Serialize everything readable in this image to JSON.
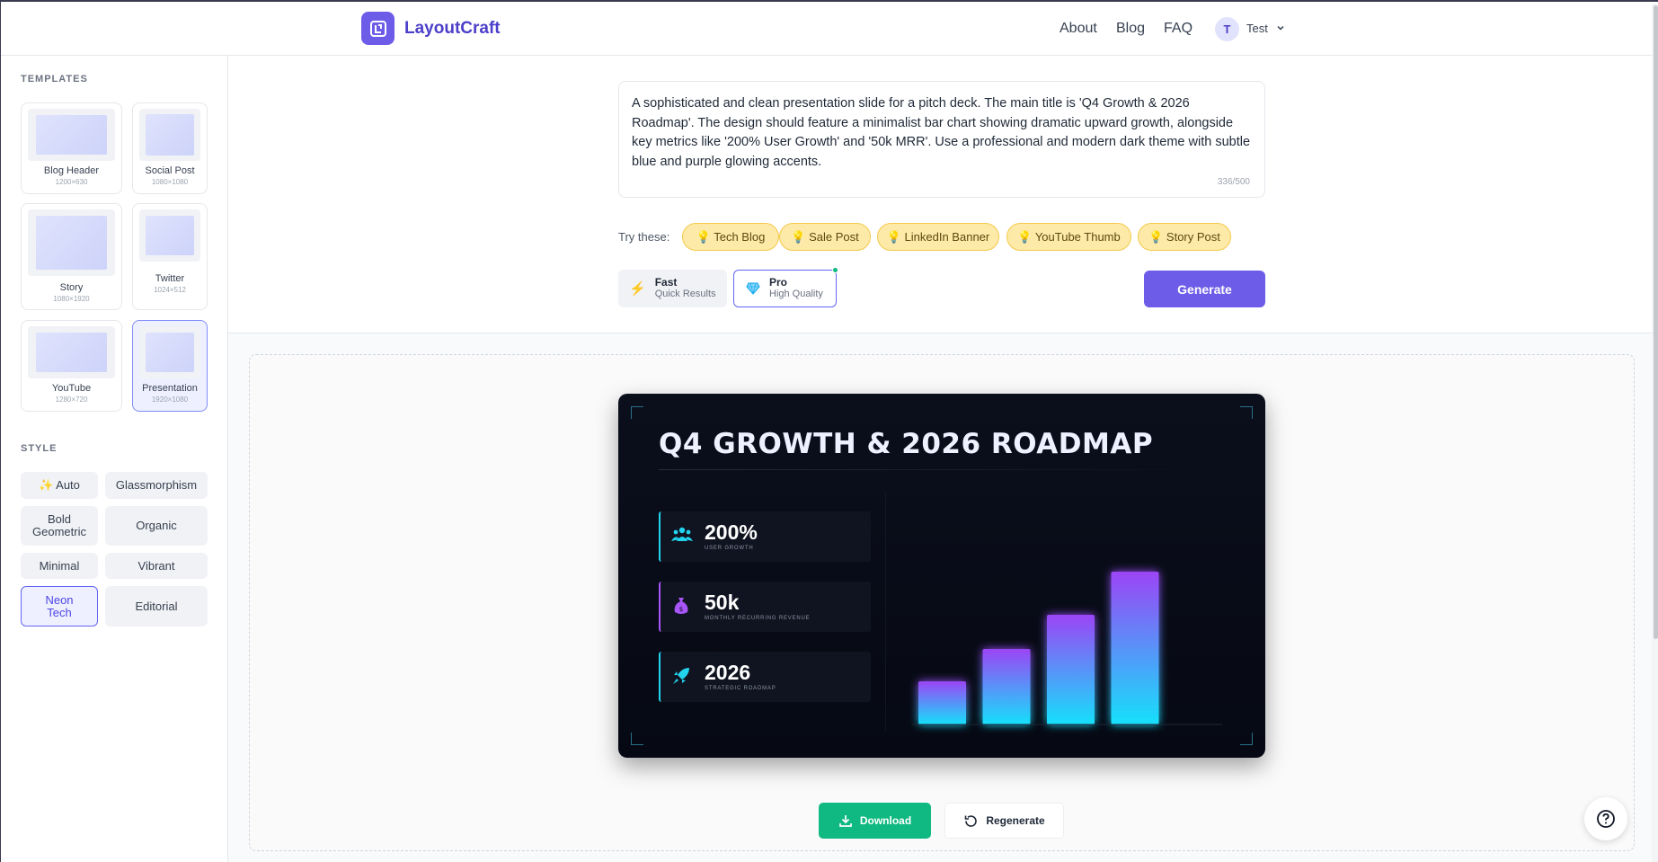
{
  "header": {
    "brand": "LayoutCraft",
    "nav": [
      "About",
      "Blog",
      "FAQ"
    ],
    "user_initial": "T",
    "user_name": "Test"
  },
  "sidebar": {
    "templates_title": "TEMPLATES",
    "templates": [
      {
        "label": "Blog Header",
        "dims": "1200×630"
      },
      {
        "label": "Social Post",
        "dims": "1080×1080"
      },
      {
        "label": "Story",
        "dims": "1080×1920"
      },
      {
        "label": "Twitter",
        "dims": "1024×512"
      },
      {
        "label": "YouTube",
        "dims": "1280×720"
      },
      {
        "label": "Presentation",
        "dims": "1920×1080",
        "selected": true
      }
    ],
    "style_title": "STYLE",
    "styles": [
      {
        "label": "✨ Auto"
      },
      {
        "label": "Glassmorphism"
      },
      {
        "label": "Bold Geometric"
      },
      {
        "label": "Organic"
      },
      {
        "label": "Minimal"
      },
      {
        "label": "Vibrant"
      },
      {
        "label": "Neon Tech",
        "selected": true
      },
      {
        "label": "Editorial"
      }
    ]
  },
  "prompt": {
    "value": "A sophisticated and clean presentation slide for a pitch deck. The main title is 'Q4 Growth & 2026 Roadmap'. The design should feature a minimalist bar chart showing dramatic upward growth, alongside key metrics like '200% User Growth' and '50k MRR'. Use a professional and modern dark theme with subtle blue and purple glowing accents.",
    "counter": "336/500"
  },
  "suggestions": {
    "label": "Try these:",
    "chips": [
      "💡 Tech Blog",
      "💡 Sale Post",
      "💡 LinkedIn Banner",
      "💡 YouTube Thumb",
      "💡 Story Post"
    ]
  },
  "modes": {
    "fast": {
      "title": "Fast",
      "subtitle": "Quick Results"
    },
    "pro": {
      "title": "Pro",
      "subtitle": "High Quality",
      "selected": true
    }
  },
  "generate_label": "Generate",
  "slide": {
    "title": "Q4 GROWTH & 2026 ROADMAP",
    "metrics": [
      {
        "value": "200%",
        "label": "USER GROWTH",
        "icon": "users-icon",
        "color": "#22d3ee"
      },
      {
        "value": "50k",
        "label": "MONTHLY RECURRING REVENUE",
        "icon": "money-bag-icon",
        "color": "#a855f7"
      },
      {
        "value": "2026",
        "label": "STRATEGIC ROADMAP",
        "icon": "rocket-icon",
        "color": "#22d3ee"
      }
    ]
  },
  "chart_data": {
    "type": "bar",
    "categories": [
      "1",
      "2",
      "3",
      "4"
    ],
    "values": [
      24,
      42,
      61,
      85
    ],
    "ylim": [
      0,
      100
    ],
    "colors": {
      "top": "#9b45f5",
      "bottom": "#16e0fb"
    }
  },
  "actions": {
    "download": "Download",
    "regenerate": "Regenerate"
  },
  "colors": {
    "brand": "#6d5ce8",
    "download": "#10b981",
    "chip_bg": "#fdeaa8"
  }
}
